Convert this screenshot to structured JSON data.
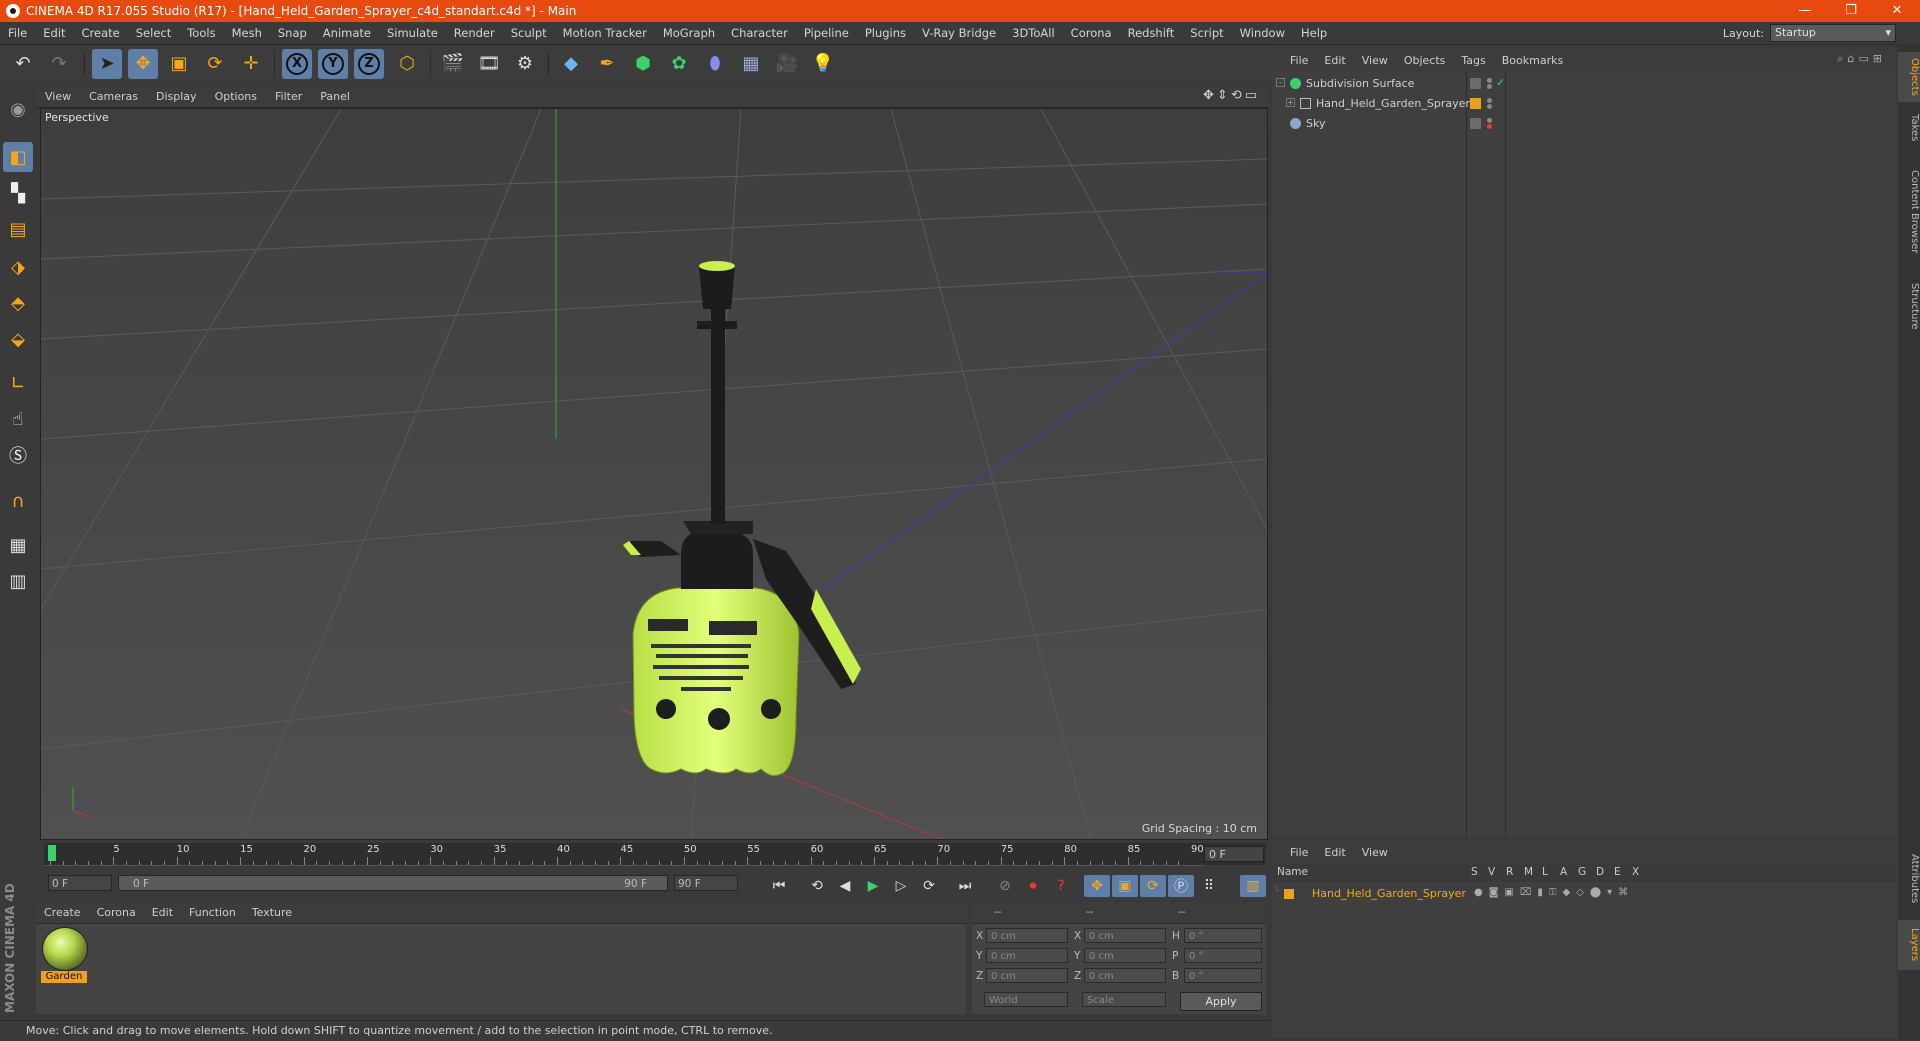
{
  "window": {
    "title": "CINEMA 4D R17.055 Studio (R17) - [Hand_Held_Garden_Sprayer_c4d_standart.c4d *] - Main",
    "controls": [
      "—",
      "❐",
      "✕"
    ]
  },
  "menu": [
    "File",
    "Edit",
    "Create",
    "Select",
    "Tools",
    "Mesh",
    "Snap",
    "Animate",
    "Simulate",
    "Render",
    "Sculpt",
    "Motion Tracker",
    "MoGraph",
    "Character",
    "Pipeline",
    "Plugins",
    "V-Ray Bridge",
    "3DToAll",
    "Corona",
    "Redshift",
    "Script",
    "Window",
    "Help"
  ],
  "layout": {
    "label": "Layout:",
    "value": "Startup"
  },
  "toolbar_icons": [
    "undo-icon",
    "redo-icon",
    "select-arrow-icon",
    "move-icon",
    "scale-icon",
    "rotate-icon",
    "live-select-icon",
    "x-axis-icon",
    "y-axis-icon",
    "z-axis-icon",
    "world-coords-icon",
    "render-view-icon",
    "render-picture-icon",
    "edit-render-settings-icon",
    "cube-icon",
    "pen-spline-icon",
    "subdivision-icon",
    "mograph-cloner-icon",
    "deformer-icon",
    "floor-icon",
    "camera-icon",
    "light-icon"
  ],
  "toolbar_axis": [
    "X",
    "Y",
    "Z"
  ],
  "viewport": {
    "menu": [
      "View",
      "Cameras",
      "Display",
      "Options",
      "Filter",
      "Panel"
    ],
    "label": "Perspective",
    "grid_spacing": "Grid Spacing : 10 cm"
  },
  "timeline": {
    "ticks": [
      "0",
      "5",
      "10",
      "15",
      "20",
      "25",
      "30",
      "35",
      "40",
      "45",
      "50",
      "55",
      "60",
      "65",
      "70",
      "75",
      "80",
      "85",
      "90"
    ],
    "current_frame": "0 F",
    "start": "0 F",
    "range_start": "0 F",
    "range_end": "90 F",
    "end": "90 F"
  },
  "materials": {
    "menu": [
      "Create",
      "Corona",
      "Edit",
      "Function",
      "Texture"
    ],
    "items": [
      {
        "name": "Garden"
      }
    ]
  },
  "coordinates": {
    "header": [
      "--",
      "--",
      "--"
    ],
    "rows": [
      {
        "a": "X",
        "v1": "0 cm",
        "b": "X",
        "v2": "0 cm",
        "c": "H",
        "v3": "0 °"
      },
      {
        "a": "Y",
        "v1": "0 cm",
        "b": "Y",
        "v2": "0 cm",
        "c": "P",
        "v3": "0 °"
      },
      {
        "a": "Z",
        "v1": "0 cm",
        "b": "Z",
        "v2": "0 cm",
        "c": "B",
        "v3": "0 °"
      }
    ],
    "mode1": "World",
    "mode2": "Scale",
    "apply": "Apply"
  },
  "status": "Move: Click and drag to move elements. Hold down SHIFT to quantize movement / add to the selection in point mode, CTRL to remove.",
  "branding": "MAXON CINEMA 4D",
  "objects": {
    "menu": [
      "File",
      "Edit",
      "View",
      "Objects",
      "Tags",
      "Bookmarks"
    ],
    "items": [
      {
        "name": "Subdivision Surface",
        "color": "#3bd16b"
      },
      {
        "name": "Hand_Held_Garden_Sprayer",
        "color": "#e8a020"
      },
      {
        "name": "Sky",
        "color": "#8a8a8a"
      }
    ]
  },
  "side_tabs": [
    "Objects",
    "Takes",
    "Content Browser",
    "Structure",
    "Attributes",
    "Layers"
  ],
  "layers": {
    "menu": [
      "File",
      "Edit",
      "View"
    ],
    "columns": [
      "Name",
      "S",
      "V",
      "R",
      "M",
      "L",
      "A",
      "G",
      "D",
      "E",
      "X"
    ],
    "items": [
      {
        "name": "Hand_Held_Garden_Sprayer",
        "color": "#e8a020"
      }
    ]
  }
}
